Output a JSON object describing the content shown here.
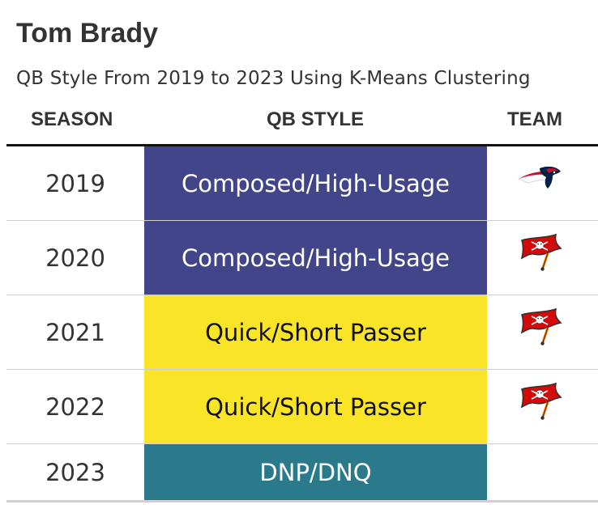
{
  "title": "Tom Brady",
  "subtitle": "QB Style From 2019 to 2023 Using K-Means Clustering",
  "headers": {
    "season": "SEASON",
    "style": "QB STYLE",
    "team": "TEAM"
  },
  "colors": {
    "composed": "#43458a",
    "quick": "#fae428",
    "dnp": "#2a7a8c",
    "text_light": "#ffffff",
    "text_dark": "#111111"
  },
  "chart_data": {
    "type": "table",
    "title": "Tom Brady",
    "subtitle": "QB Style From 2019 to 2023 Using K-Means Clustering",
    "columns": [
      "SEASON",
      "QB STYLE",
      "TEAM"
    ],
    "rows": [
      {
        "season": "2019",
        "style": "Composed/High-Usage",
        "style_color": "#43458a",
        "text_color": "#ffffff",
        "team_icon": "patriots-logo-icon"
      },
      {
        "season": "2020",
        "style": "Composed/High-Usage",
        "style_color": "#43458a",
        "text_color": "#ffffff",
        "team_icon": "buccaneers-flag-icon"
      },
      {
        "season": "2021",
        "style": "Quick/Short Passer",
        "style_color": "#fae428",
        "text_color": "#111111",
        "team_icon": "buccaneers-flag-icon"
      },
      {
        "season": "2022",
        "style": "Quick/Short Passer",
        "style_color": "#fae428",
        "text_color": "#111111",
        "team_icon": "buccaneers-flag-icon"
      },
      {
        "season": "2023",
        "style": "DNP/DNQ",
        "style_color": "#2a7a8c",
        "text_color": "#ffffff",
        "team_icon": ""
      }
    ]
  }
}
